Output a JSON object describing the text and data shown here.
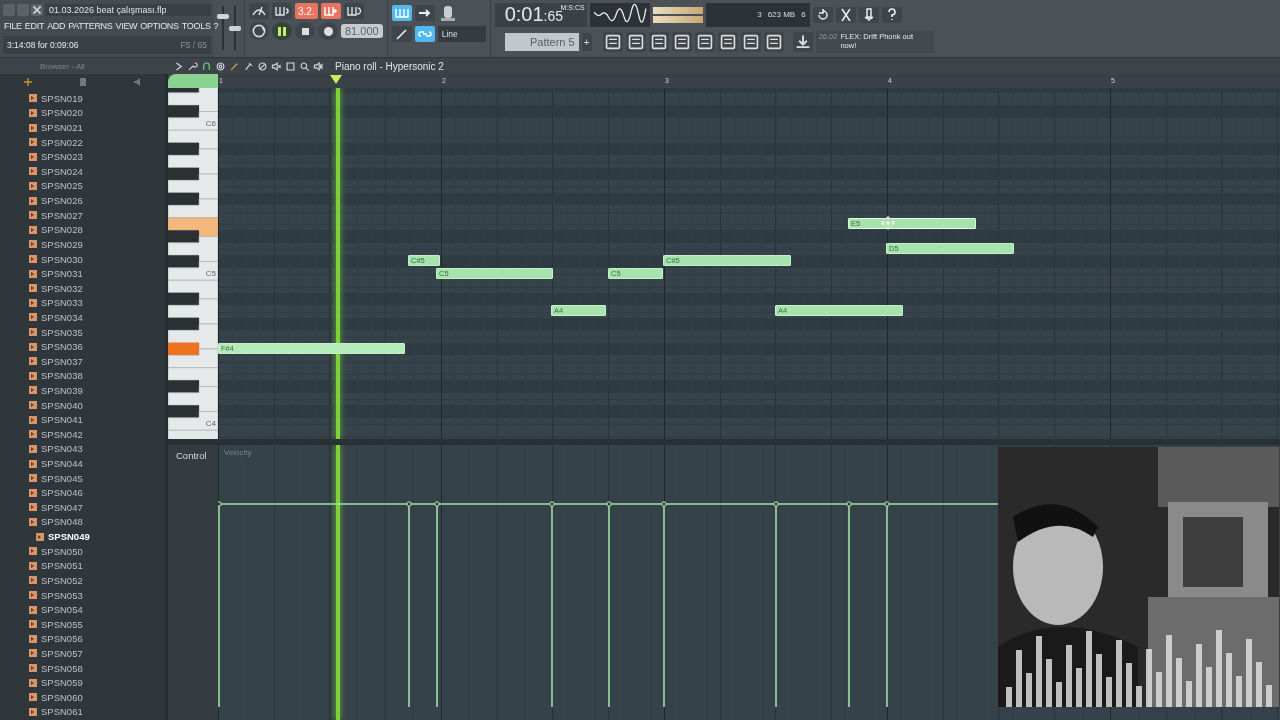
{
  "title_bar": {
    "filename": "01.03.2026 beat çalışması.flp",
    "menu": [
      "FILE",
      "EDIT",
      "ADD",
      "PATTERNS",
      "VIEW",
      "OPTIONS",
      "TOOLS",
      "?"
    ],
    "hint": "3:14:08 for 0:09:06",
    "hint_right": "F5 / 65"
  },
  "master": {
    "volume": {
      "level": 0.8
    },
    "pitch": {
      "level": 0.5
    }
  },
  "transport": {
    "mode_label": "3.2.",
    "playing": true,
    "tempo": "81.000",
    "snap": "Line",
    "time": "0:01",
    "time_small": ":65",
    "time_unit": "M:S:CS",
    "cpu": "3",
    "memory": "623 MB",
    "polyphony": "6",
    "pattern": "Pattern 5",
    "pattern_add": "+",
    "news_date": "26.02",
    "news": "FLEX: Drift Phonk out now!"
  },
  "browser": {
    "title": "Browser - All",
    "items": [
      {
        "label": "SPSN019",
        "selected": false
      },
      {
        "label": "SPSN020",
        "selected": false
      },
      {
        "label": "SPSN021",
        "selected": false
      },
      {
        "label": "SPSN022",
        "selected": false
      },
      {
        "label": "SPSN023",
        "selected": false
      },
      {
        "label": "SPSN024",
        "selected": false
      },
      {
        "label": "SPSN025",
        "selected": false
      },
      {
        "label": "SPSN026",
        "selected": false
      },
      {
        "label": "SPSN027",
        "selected": false
      },
      {
        "label": "SPSN028",
        "selected": false
      },
      {
        "label": "SPSN029",
        "selected": false
      },
      {
        "label": "SPSN030",
        "selected": false
      },
      {
        "label": "SPSN031",
        "selected": false
      },
      {
        "label": "SPSN032",
        "selected": false
      },
      {
        "label": "SPSN033",
        "selected": false
      },
      {
        "label": "SPSN034",
        "selected": false
      },
      {
        "label": "SPSN035",
        "selected": false
      },
      {
        "label": "SPSN036",
        "selected": false
      },
      {
        "label": "SPSN037",
        "selected": false
      },
      {
        "label": "SPSN038",
        "selected": false
      },
      {
        "label": "SPSN039",
        "selected": false
      },
      {
        "label": "SPSN040",
        "selected": false
      },
      {
        "label": "SPSN041",
        "selected": false
      },
      {
        "label": "SPSN042",
        "selected": false
      },
      {
        "label": "SPSN043",
        "selected": false
      },
      {
        "label": "SPSN044",
        "selected": false
      },
      {
        "label": "SPSN045",
        "selected": false
      },
      {
        "label": "SPSN046",
        "selected": false
      },
      {
        "label": "SPSN047",
        "selected": false
      },
      {
        "label": "SPSN048",
        "selected": false
      },
      {
        "label": "SPSN049",
        "selected": true
      },
      {
        "label": "SPSN050",
        "selected": false
      },
      {
        "label": "SPSN051",
        "selected": false
      },
      {
        "label": "SPSN052",
        "selected": false
      },
      {
        "label": "SPSN053",
        "selected": false
      },
      {
        "label": "SPSN054",
        "selected": false
      },
      {
        "label": "SPSN055",
        "selected": false
      },
      {
        "label": "SPSN056",
        "selected": false
      },
      {
        "label": "SPSN057",
        "selected": false
      },
      {
        "label": "SPSN058",
        "selected": false
      },
      {
        "label": "SPSN059",
        "selected": false
      },
      {
        "label": "SPSN060",
        "selected": false
      },
      {
        "label": "SPSN061",
        "selected": false
      }
    ]
  },
  "piano_roll": {
    "title": "Piano roll - Hypersonic 2",
    "ruler": [
      "1",
      "2",
      "3",
      "4",
      "5"
    ],
    "key_labels": [
      "C6",
      "C5",
      "C4"
    ],
    "notes": [
      {
        "label": "F#4",
        "playing": true,
        "hovered": false
      },
      {
        "label": "C#5",
        "playing": false,
        "hovered": false
      },
      {
        "label": "C5",
        "playing": false,
        "hovered": false
      },
      {
        "label": "A4",
        "playing": false,
        "hovered": false
      },
      {
        "label": "C5",
        "playing": false,
        "hovered": false
      },
      {
        "label": "C#5",
        "playing": false,
        "hovered": false
      },
      {
        "label": "A4",
        "playing": false,
        "hovered": false
      },
      {
        "label": "E5",
        "playing": false,
        "hovered": true
      },
      {
        "label": "D5",
        "playing": false,
        "hovered": false
      }
    ],
    "control_label": "Control",
    "lane_label": "Velocity"
  }
}
